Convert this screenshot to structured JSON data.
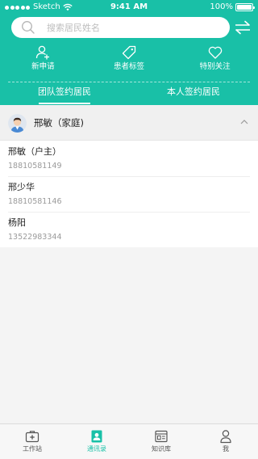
{
  "status_bar": {
    "carrier": "Sketch",
    "time": "9:41 AM",
    "battery": "100%"
  },
  "search": {
    "placeholder": "搜索居民姓名"
  },
  "quick_actions": [
    {
      "label": "新申请",
      "icon": "add-user-icon"
    },
    {
      "label": "患者标签",
      "icon": "tag-icon"
    },
    {
      "label": "特别关注",
      "icon": "heart-icon"
    }
  ],
  "tabs": [
    {
      "label": "团队签约居民",
      "active": true
    },
    {
      "label": "本人签约居民",
      "active": false
    }
  ],
  "group": {
    "title": "邢敏（家庭)",
    "expanded": true
  },
  "members": [
    {
      "name": "邢敏（户主）",
      "phone": "18810581149"
    },
    {
      "name": "邢少华",
      "phone": "18810581146"
    },
    {
      "name": "杨阳",
      "phone": "13522983344"
    }
  ],
  "tabbar": [
    {
      "label": "工作站",
      "icon": "medical-kit-icon",
      "active": false
    },
    {
      "label": "通讯录",
      "icon": "contacts-icon",
      "active": true
    },
    {
      "label": "知识库",
      "icon": "knowledge-icon",
      "active": false
    },
    {
      "label": "我",
      "icon": "person-icon",
      "active": false
    }
  ],
  "colors": {
    "accent": "#19c0a7",
    "background": "#f4f4f4"
  }
}
